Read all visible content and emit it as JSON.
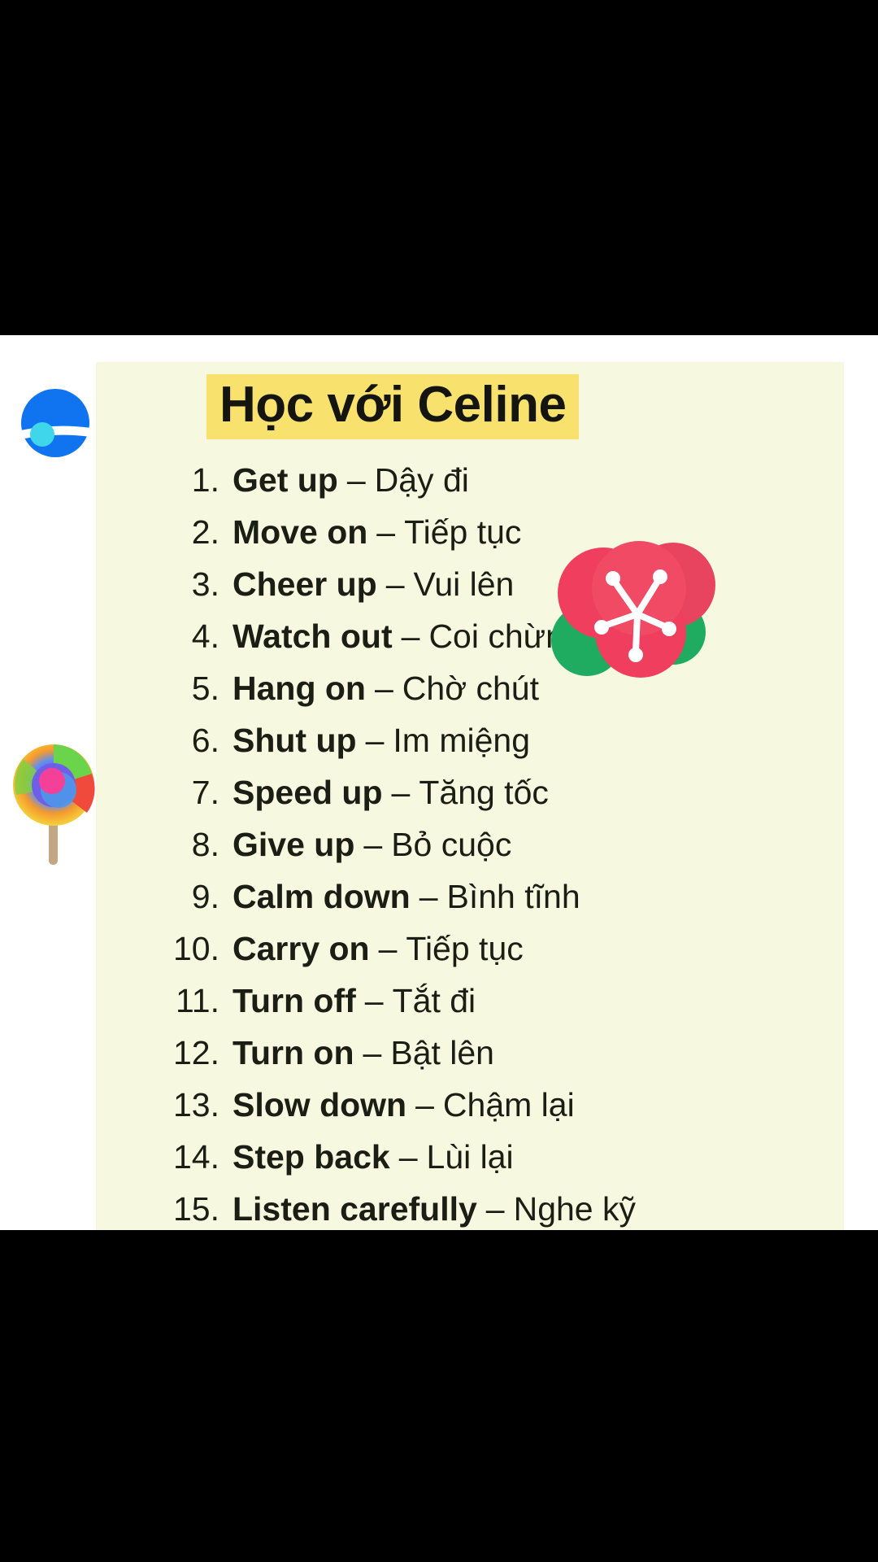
{
  "card": {
    "title": "Học với Celine",
    "background_color": "#f7f8e0",
    "title_highlight_color": "#f8e16c",
    "text_color": "#1b1e14"
  },
  "list": {
    "separator": "–",
    "items": [
      {
        "number": "1.",
        "phrase": "Get up",
        "meaning": "Dậy đi"
      },
      {
        "number": "2.",
        "phrase": "Move on",
        "meaning": "Tiếp tục"
      },
      {
        "number": "3.",
        "phrase": "Cheer up",
        "meaning": "Vui lên"
      },
      {
        "number": "4.",
        "phrase": "Watch out",
        "meaning": "Coi chừng"
      },
      {
        "number": "5.",
        "phrase": "Hang on",
        "meaning": "Chờ chút"
      },
      {
        "number": "6.",
        "phrase": "Shut up",
        "meaning": "Im miệng"
      },
      {
        "number": "7.",
        "phrase": "Speed up",
        "meaning": "Tăng tốc"
      },
      {
        "number": "8.",
        "phrase": "Give up",
        "meaning": "Bỏ cuộc"
      },
      {
        "number": "9.",
        "phrase": "Calm down",
        "meaning": "Bình tĩnh"
      },
      {
        "number": "10.",
        "phrase": "Carry on",
        "meaning": "Tiếp tục"
      },
      {
        "number": "11.",
        "phrase": "Turn off",
        "meaning": "Tắt đi"
      },
      {
        "number": "12.",
        "phrase": "Turn on",
        "meaning": "Bật lên"
      },
      {
        "number": "13.",
        "phrase": "Slow down",
        "meaning": "Chậm lại"
      },
      {
        "number": "14.",
        "phrase": "Step back",
        "meaning": "Lùi lại"
      },
      {
        "number": "15.",
        "phrase": "Listen carefully",
        "meaning": "Nghe kỹ"
      }
    ]
  },
  "stickers": {
    "planet": {
      "name": "planet-sticker",
      "primary_color": "#1073ef",
      "accent_color": "#3fd6ec",
      "ring_color": "#ffffff"
    },
    "lollipop": {
      "name": "lollipop-sticker",
      "colors": [
        "#6ad44a",
        "#f04a3c",
        "#f59a2e",
        "#f5d93c",
        "#5f8ef0",
        "#8a55e8",
        "#f5409a"
      ],
      "stick_color": "#c3a783"
    },
    "flower": {
      "name": "flower-sticker",
      "petal_color": "#ef3e5e",
      "petal_shadow": "#e8435f",
      "leaf_color": "#1fab60",
      "stamen_color": "#ffffff"
    }
  }
}
